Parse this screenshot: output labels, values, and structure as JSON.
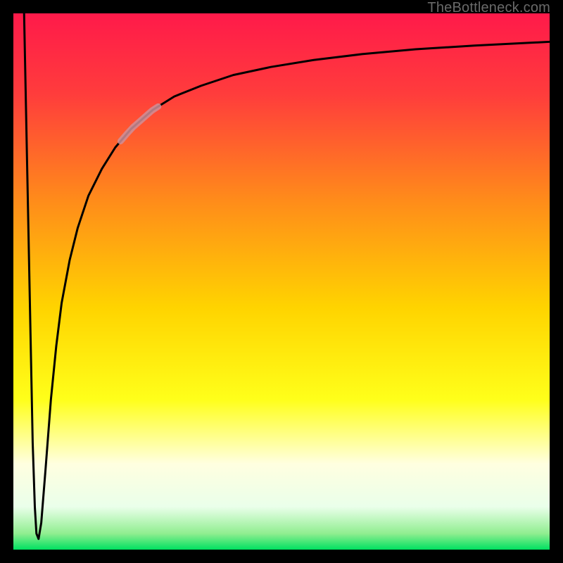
{
  "watermark": "TheBottleneck.com",
  "chart_data": {
    "type": "line",
    "title": "",
    "xlabel": "",
    "ylabel": "",
    "xlim": [
      0,
      100
    ],
    "ylim": [
      0,
      100
    ],
    "grid": false,
    "legend": false,
    "background_gradient": {
      "stops": [
        {
          "offset": 0.0,
          "color": "#ff1a4a"
        },
        {
          "offset": 0.15,
          "color": "#ff3c3c"
        },
        {
          "offset": 0.35,
          "color": "#ff8c1a"
        },
        {
          "offset": 0.55,
          "color": "#ffd400"
        },
        {
          "offset": 0.72,
          "color": "#ffff1a"
        },
        {
          "offset": 0.84,
          "color": "#ffffe0"
        },
        {
          "offset": 0.92,
          "color": "#eaffea"
        },
        {
          "offset": 0.97,
          "color": "#90ee90"
        },
        {
          "offset": 1.0,
          "color": "#00e060"
        }
      ]
    },
    "series": [
      {
        "name": "curve",
        "x": [
          2.0,
          2.6,
          3.2,
          3.6,
          4.0,
          4.3,
          4.7,
          5.2,
          6.0,
          7.0,
          8.0,
          9.0,
          10.5,
          12.0,
          14.0,
          16.5,
          19.0,
          22.0,
          26.0,
          30.0,
          35.0,
          41.0,
          48.0,
          56.0,
          65.0,
          75.0,
          86.0,
          100.0
        ],
        "y": [
          100.0,
          70.0,
          40.0,
          20.0,
          8.0,
          3.0,
          2.0,
          5.0,
          15.0,
          28.0,
          38.0,
          46.0,
          54.0,
          60.0,
          66.0,
          71.0,
          75.0,
          78.5,
          82.0,
          84.5,
          86.5,
          88.5,
          90.0,
          91.3,
          92.4,
          93.3,
          94.0,
          94.7
        ]
      }
    ],
    "highlight_segment": {
      "series": "curve",
      "x_range": [
        20.0,
        27.0
      ],
      "color": "#cf8f99",
      "width": 9
    }
  }
}
